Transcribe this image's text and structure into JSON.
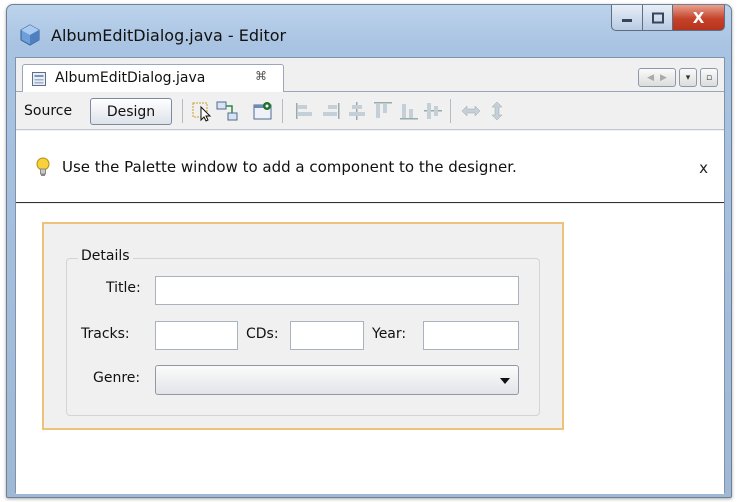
{
  "window": {
    "title": "AlbumEditDialog.java - Editor",
    "close_glyph": "X"
  },
  "tabs": [
    {
      "label": "AlbumEditDialog.java",
      "close_glyph": "⌘"
    }
  ],
  "tab_nav": {
    "left": "◀",
    "right": "▶",
    "menu": "▾",
    "restore": "▫"
  },
  "toolbar": {
    "source_label": "Source",
    "design_label": "Design",
    "icons": [
      "selection-mode-icon",
      "connection-mode-icon",
      "preview-design-icon",
      "align-left-icon",
      "align-right-icon",
      "center-horizontally-icon",
      "align-top-icon",
      "align-bottom-icon",
      "center-vertically-icon",
      "resize-horizontal-icon",
      "resize-vertical-icon"
    ]
  },
  "info": {
    "message": "Use the Palette window to add a component to the designer.",
    "close_label": "x"
  },
  "form": {
    "group_title": "Details",
    "title_label": "Title:",
    "tracks_label": "Tracks:",
    "cds_label": "CDs:",
    "year_label": "Year:",
    "genre_label": "Genre:",
    "title_value": "",
    "tracks_value": "",
    "cds_value": "",
    "year_value": "",
    "genre_value": ""
  },
  "colors": {
    "selection_border": "#efc27a",
    "window_frame": "#a9c3e2",
    "close_button": "#c5432a"
  }
}
